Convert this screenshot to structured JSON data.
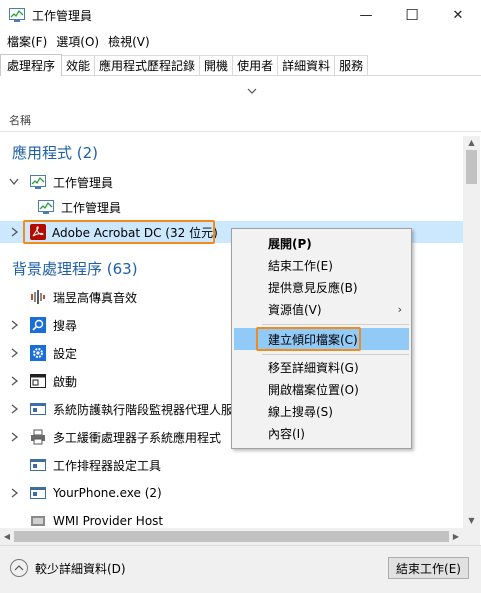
{
  "window": {
    "title": "工作管理員",
    "minimize_glyph": "—",
    "maximize_glyph": "☐",
    "close_glyph": "✕"
  },
  "menu": [
    "檔案(F)",
    "選項(O)",
    "檢視(V)"
  ],
  "tabs": [
    {
      "label": "處理程序",
      "active": true
    },
    {
      "label": "效能",
      "active": false
    },
    {
      "label": "應用程式歷程記錄",
      "active": false
    },
    {
      "label": "開機",
      "active": false
    },
    {
      "label": "使用者",
      "active": false
    },
    {
      "label": "詳細資料",
      "active": false
    },
    {
      "label": "服務",
      "active": false
    }
  ],
  "column_header": "名稱",
  "groups": {
    "apps": "應用程式 (2)",
    "background": "背景處理程序 (63)"
  },
  "rows": {
    "task_manager_group": "工作管理員",
    "task_manager_child": "工作管理員",
    "acrobat": "Adobe Acrobat DC (32 位元)",
    "realtek": "瑞昱高傳真音效",
    "search": "搜尋",
    "settings": "設定",
    "startup": "啟動",
    "antimalware": "系統防護執行階段監視器代理人服",
    "multithread": "多工緩衝處理器子系統應用程式",
    "task_scheduler": "工作排程器設定工具",
    "yourphone": "YourPhone.exe (2)",
    "wmi": "WMI Provider Host"
  },
  "context_menu": {
    "expand": "展開(P)",
    "end_task": "結束工作(E)",
    "feedback": "提供意見反應(B)",
    "resource_values": "資源值(V)",
    "create_dump": "建立傾印檔案(C)",
    "go_to_details": "移至詳細資料(G)",
    "open_file_location": "開啟檔案位置(O)",
    "search_online": "線上搜尋(S)",
    "properties": "內容(I)"
  },
  "footer": {
    "fewer_details": "較少詳細資料(D)",
    "end_task": "結束工作(E)"
  },
  "colors": {
    "accent_blue": "#1e5fa8",
    "selection": "#cce8ff",
    "menu_hover": "#91c9f7",
    "highlight_box": "#f08c1e"
  }
}
